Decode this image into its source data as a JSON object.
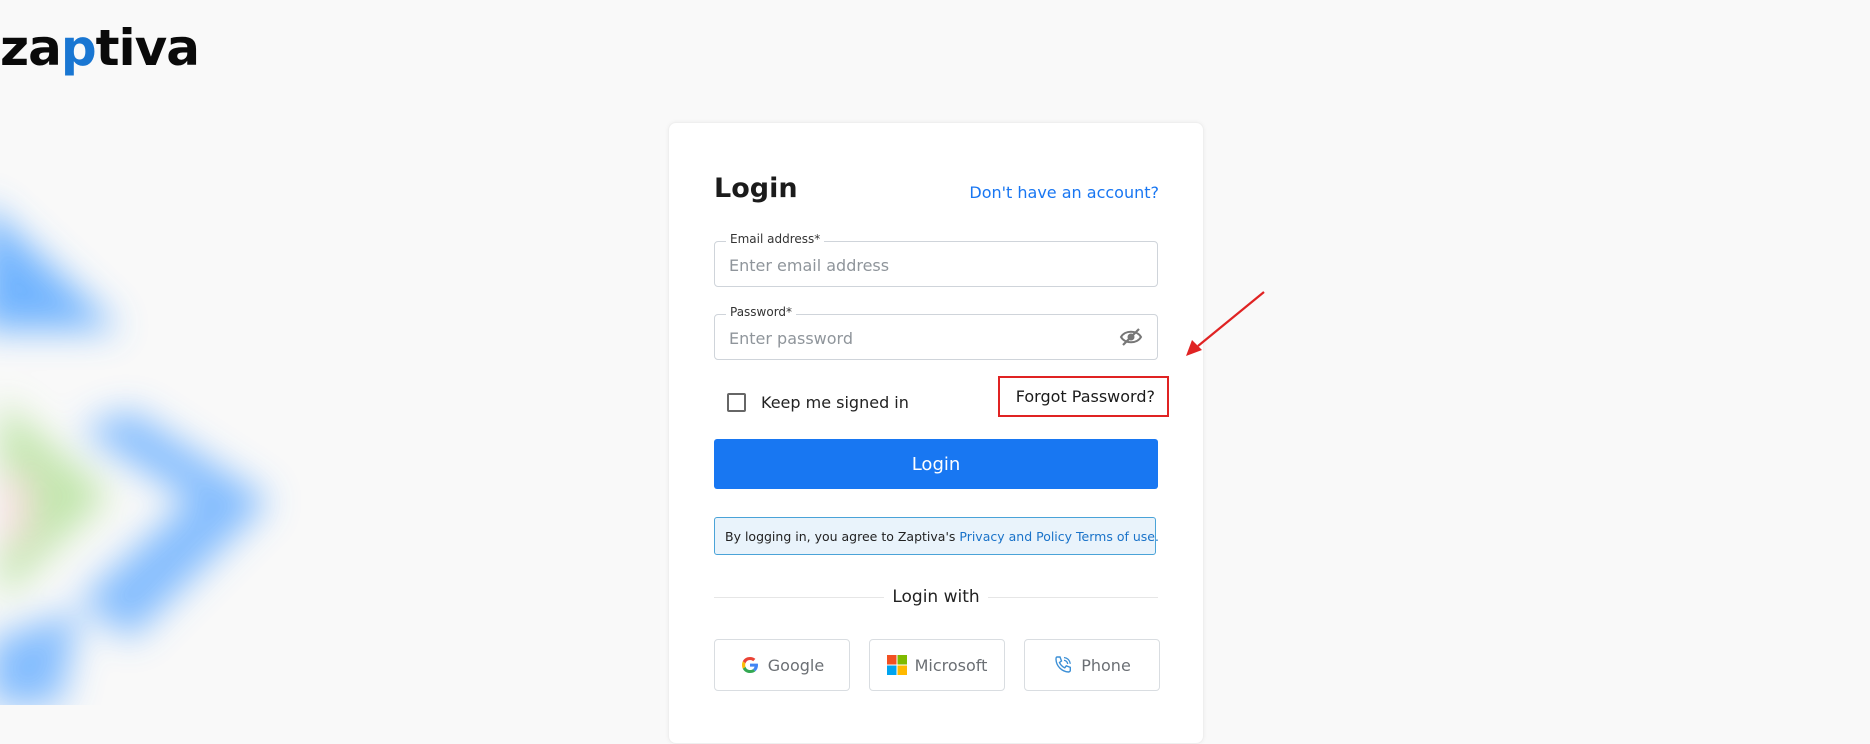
{
  "brand": {
    "logo_text_pre": "za",
    "logo_text_o": "p",
    "logo_text_post": "tiva"
  },
  "login_form": {
    "title": "Login",
    "signup_link": "Don't have an account?",
    "email": {
      "label": "Email address*",
      "placeholder": "Enter email address"
    },
    "password": {
      "label": "Password*",
      "placeholder": "Enter password",
      "visibility_icon": "eye-slash-icon"
    },
    "remember_label": "Keep me signed in",
    "forgot_label": "Forgot Password?",
    "login_button": "Login",
    "terms": {
      "prefix": "By logging in, you agree to Zaptiva's ",
      "privacy_link": "Privacy and Policy",
      "terms_link": "Terms of use."
    },
    "divider_label": "Login with",
    "social": [
      {
        "label": "Google",
        "icon": "google-icon"
      },
      {
        "label": "Microsoft",
        "icon": "microsoft-icon"
      },
      {
        "label": "Phone",
        "icon": "phone-icon"
      }
    ]
  },
  "colors": {
    "primary": "#1877f2",
    "highlight": "#e02323",
    "link": "#1876f2"
  }
}
